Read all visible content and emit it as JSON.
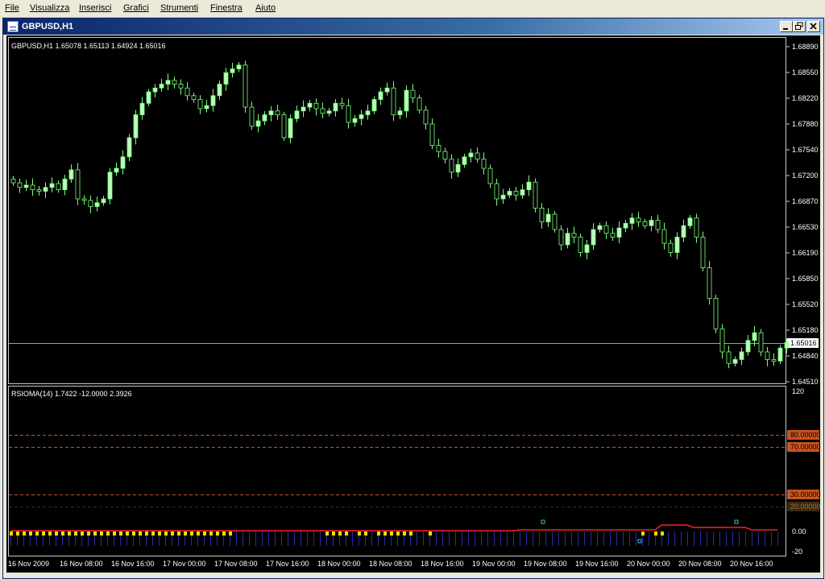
{
  "menu": {
    "items": [
      "File",
      "Visualizza",
      "Inserisci",
      "Grafici",
      "Strumenti",
      "Finestra",
      "Aiuto"
    ]
  },
  "window": {
    "title": "GBPUSD,H1",
    "minimize_glyph": "_",
    "restore_glyph": "□",
    "close_glyph": "✕"
  },
  "chart": {
    "header": "GBPUSD,H1  1.65078 1.65113 1.64924 1.65016",
    "price_ticks": [
      "1.68890",
      "1.68550",
      "1.68220",
      "1.67880",
      "1.67540",
      "1.67200",
      "1.66870",
      "1.66530",
      "1.66190",
      "1.65850",
      "1.65520",
      "1.65180",
      "1.64840",
      "1.64510"
    ],
    "current_price": "1.65016",
    "colors": {
      "bull": "#b6ffb6",
      "bear": "#000000",
      "wick": "#7cff7c",
      "grid": "#c8c8c8"
    }
  },
  "indicator": {
    "header": "RSIOMA(14) 1.7422 -12.0000 2.3926",
    "levels": [
      {
        "label": "80.00000",
        "value": 80,
        "color": "#c8551e"
      },
      {
        "label": "70.00000",
        "value": 70,
        "color": "#c8551e"
      },
      {
        "label": "30.00000",
        "value": 30,
        "color": "#c8551e"
      },
      {
        "label": "20.00000",
        "value": 20,
        "color": "#3a2a10"
      }
    ],
    "scale_ticks": [
      "120",
      "0.00",
      "-20"
    ]
  },
  "time_axis": [
    "16 Nov 2009",
    "16 Nov 08:00",
    "16 Nov 16:00",
    "17 Nov 00:00",
    "17 Nov 08:00",
    "17 Nov 16:00",
    "18 Nov 00:00",
    "18 Nov 08:00",
    "18 Nov 16:00",
    "19 Nov 00:00",
    "19 Nov 08:00",
    "19 Nov 16:00",
    "20 Nov 00:00",
    "20 Nov 08:00",
    "20 Nov 16:00"
  ],
  "chart_data": {
    "type": "candlestick",
    "symbol": "GBPUSD",
    "timeframe": "H1",
    "ylim": [
      1.6451,
      1.6889
    ],
    "close": [
      1.6711,
      1.6705,
      1.6708,
      1.6702,
      1.67,
      1.6705,
      1.671,
      1.6702,
      1.6716,
      1.6728,
      1.669,
      1.6688,
      1.668,
      1.6685,
      1.669,
      1.6725,
      1.673,
      1.6745,
      1.677,
      1.68,
      1.6815,
      1.683,
      1.6835,
      1.684,
      1.6845,
      1.684,
      1.6835,
      1.6825,
      1.682,
      1.6808,
      1.6812,
      1.6825,
      1.684,
      1.6855,
      1.686,
      1.6865,
      1.681,
      1.6785,
      1.6792,
      1.68,
      1.6805,
      1.68,
      1.677,
      1.6795,
      1.6805,
      1.681,
      1.6815,
      1.6808,
      1.6802,
      1.6805,
      1.6815,
      1.6812,
      1.679,
      1.6795,
      1.68,
      1.6805,
      1.682,
      1.683,
      1.6835,
      1.68,
      1.6805,
      1.6832,
      1.6822,
      1.6806,
      1.6788,
      1.676,
      1.6752,
      1.6742,
      1.6725,
      1.6735,
      1.6745,
      1.675,
      1.6742,
      1.673,
      1.671,
      1.669,
      1.6695,
      1.67,
      1.6695,
      1.6702,
      1.6712,
      1.6678,
      1.666,
      1.667,
      1.665,
      1.663,
      1.6645,
      1.664,
      1.662,
      1.663,
      1.665,
      1.6655,
      1.6645,
      1.664,
      1.6652,
      1.6658,
      1.6665,
      1.666,
      1.6655,
      1.6662,
      1.665,
      1.6632,
      1.662,
      1.664,
      1.6655,
      1.6665,
      1.664,
      1.66,
      1.656,
      1.652,
      1.649,
      1.6475,
      1.648,
      1.649,
      1.6505,
      1.6515,
      1.649,
      1.648,
      1.6478,
      1.6495,
      1.6502
    ]
  }
}
